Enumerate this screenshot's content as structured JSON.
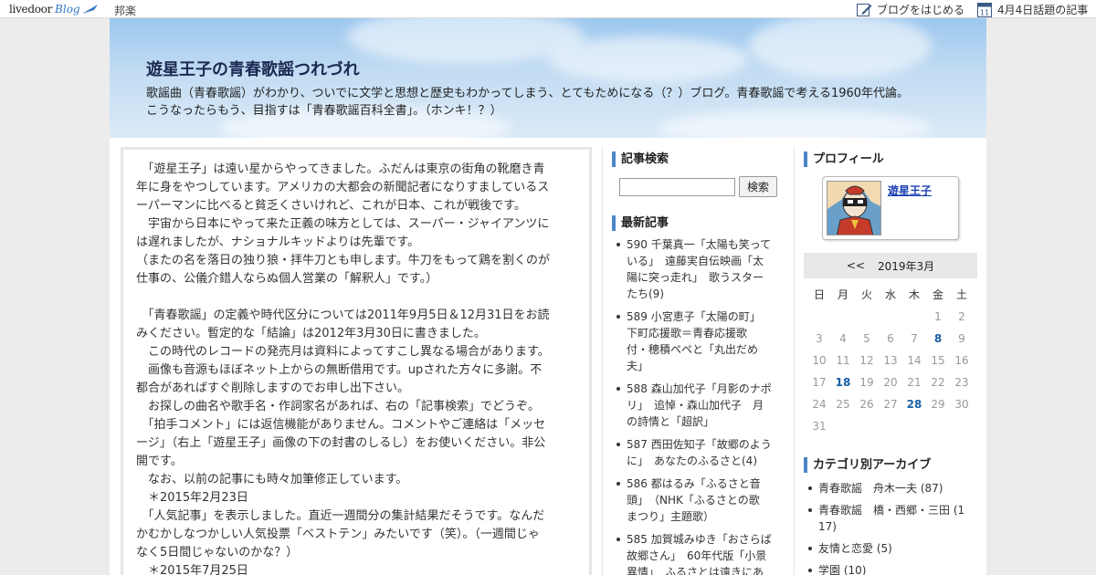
{
  "topbar": {
    "logo_text": "livedoor",
    "logo_blog": "Blog",
    "category": "邦楽",
    "start_blog": "ブログをはじめる",
    "topic": "4月4日話題の記事",
    "calendar_icon_day": "11"
  },
  "header": {
    "title": "遊星王子の青春歌謡つれづれ",
    "desc_line1": "歌謡曲（青春歌謡）がわかり、ついでに文学と思想と歴史もわかってしまう、とてもためになる（？）ブログ。青春歌謡で考える1960年代論。",
    "desc_line2": "こうなったらもう、目指すは「青春歌謡百科全書」。（ホンキ！？）"
  },
  "article": {
    "lines": [
      "　「遊星王子」は遠い星からやってきました。ふだんは東京の街角の靴磨き青",
      "年に身をやつしています。アメリカの大都会の新聞記者になりすましているス",
      "ーパーマンに比べると貧乏くさいけれど、これが日本、これが戦後です。",
      "　宇宙から日本にやって来た正義の味方としては、スーパー・ジャイアンツに",
      "は遅れましたが、ナショナルキッドよりは先輩です。",
      "（またの名を落日の独り狼・拝牛刀とも申します。牛刀をもって鶏を割くのが",
      "仕事の、公儀介錯人ならぬ個人営業の「解釈人」です。）",
      "",
      "　「青春歌謡」の定義や時代区分については2011年9月5日＆12月31日をお読",
      "みください。暫定的な「結論」は2012年3月30日に書きました。",
      "　この時代のレコードの発売月は資料によってすこし異なる場合があります。",
      "　画像も音源もほぼネット上からの無断借用です。upされた方々に多謝。不",
      "都合があればすぐ削除しますのでお申し出下さい。",
      "　お探しの曲名や歌手名・作詞家名があれば、右の「記事検索」でどうぞ。",
      "　「拍手コメント」には返信機能がありません。コメントやご連絡は「メッセ",
      "ージ」（右上「遊星王子」画像の下の封書のしるし）をお使いください。非公",
      "開です。",
      "　なお、以前の記事にも時々加筆修正しています。",
      "　＊2015年2月23日",
      "　「人気記事」を表示しました。直近一週間分の集計結果だそうです。なんだ",
      "かむかしなつかしい人気投票「ベストテン」みたいです（笑）。（一週間じゃ",
      "なく5日間じゃないのかな？）",
      "　＊2015年7月25日"
    ]
  },
  "search": {
    "heading": "記事検索",
    "input_value": "",
    "button": "検索"
  },
  "recent": {
    "heading": "最新記事",
    "items": [
      [
        "590 千葉真一「太陽も笑って",
        "いる」　遠藤実自伝映画「太",
        "陽に突っ走れ」　歌うスター",
        "たち(9)"
      ],
      [
        "589 小宮恵子「太陽の町」",
        "下町応援歌＝青春応援歌",
        "付・穂積ペペと「丸出だめ",
        "夫」"
      ],
      [
        "588 森山加代子「月影のナポ",
        "リ」　追悼・森山加代子　月",
        "の詩情と「超訳」"
      ],
      [
        "587 西田佐知子「故郷のよう",
        "に」　あなたのふるさと(4)"
      ],
      [
        "586 都はるみ「ふるさと音",
        "頭」　（NHK「ふるさとの歌",
        "まつり」主題歌）"
      ],
      [
        "585 加賀城みゆき「おさらば",
        "故郷さん」　60年代版「小景",
        "異情」　ふるさとは遠きにあ"
      ]
    ]
  },
  "profile": {
    "heading": "プロフィール",
    "name": "遊星王子"
  },
  "calendar": {
    "prev": "<<",
    "month": "2019年3月",
    "dow": [
      "日",
      "月",
      "火",
      "水",
      "木",
      "金",
      "土"
    ],
    "days": [
      "",
      "",
      "",
      "",
      "",
      "1",
      "2",
      "3",
      "4",
      "5",
      "6",
      "7",
      "8",
      "9",
      "10",
      "11",
      "12",
      "13",
      "14",
      "15",
      "16",
      "17",
      "18",
      "19",
      "20",
      "21",
      "22",
      "23",
      "24",
      "25",
      "26",
      "27",
      "28",
      "29",
      "30",
      "31"
    ],
    "linked_days": [
      "8",
      "18",
      "28"
    ]
  },
  "archive": {
    "heading": "カテゴリ別アーカイブ",
    "items": [
      [
        "青春歌謡　舟木一夫 (87)"
      ],
      [
        "青春歌謡　橋・西郷・三田 (1",
        "17)"
      ],
      [
        "友情と恋愛 (5)"
      ],
      [
        "学園 (10)"
      ]
    ]
  },
  "colors": {
    "accent_bar": "#4a86c5",
    "link": "#1a5fa8",
    "profile_link": "#1a3fb0"
  }
}
